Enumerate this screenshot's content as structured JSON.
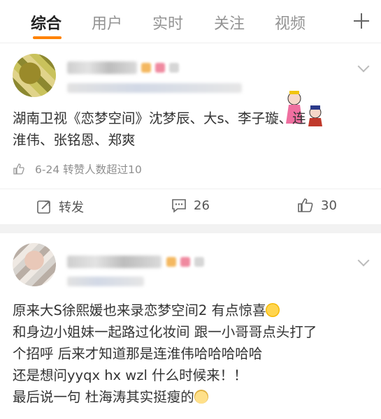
{
  "tabs": [
    {
      "label": "综合",
      "active": true
    },
    {
      "label": "用户",
      "active": false
    },
    {
      "label": "实时",
      "active": false
    },
    {
      "label": "关注",
      "active": false
    },
    {
      "label": "视频",
      "active": false
    }
  ],
  "posts": [
    {
      "content_lines": [
        "湖南卫视《恋梦空间》沈梦辰、大s、李子璇、连",
        "淮伟、张铭恩、郑爽"
      ],
      "meta": "6-24 转赞人数超过10",
      "actions": {
        "repost_label": "转发",
        "comment_count": "26",
        "like_count": "30"
      }
    },
    {
      "content_lines": [
        "原来大S徐熙媛也来录恋梦空间2 有点惊喜",
        "和身边小姐妹一起路过化妆间 跟一小哥哥点头打了",
        "个招呼 后来才知道那是连淮伟哈哈哈哈哈",
        "还是想问yyqx  hx  wzl  什么时候来！！",
        "最后说一句 杜海涛其实挺瘦的"
      ]
    }
  ],
  "colors": {
    "accent": "#ff8200",
    "tab_inactive": "#939393",
    "meta_text": "#8f8f8f",
    "separator": "#f2f2f2"
  },
  "icons": {
    "plus": "plus-icon",
    "chevron": "chevron-down-icon",
    "repost": "share-icon",
    "comment": "comment-icon",
    "like": "thumbs-up-icon"
  }
}
